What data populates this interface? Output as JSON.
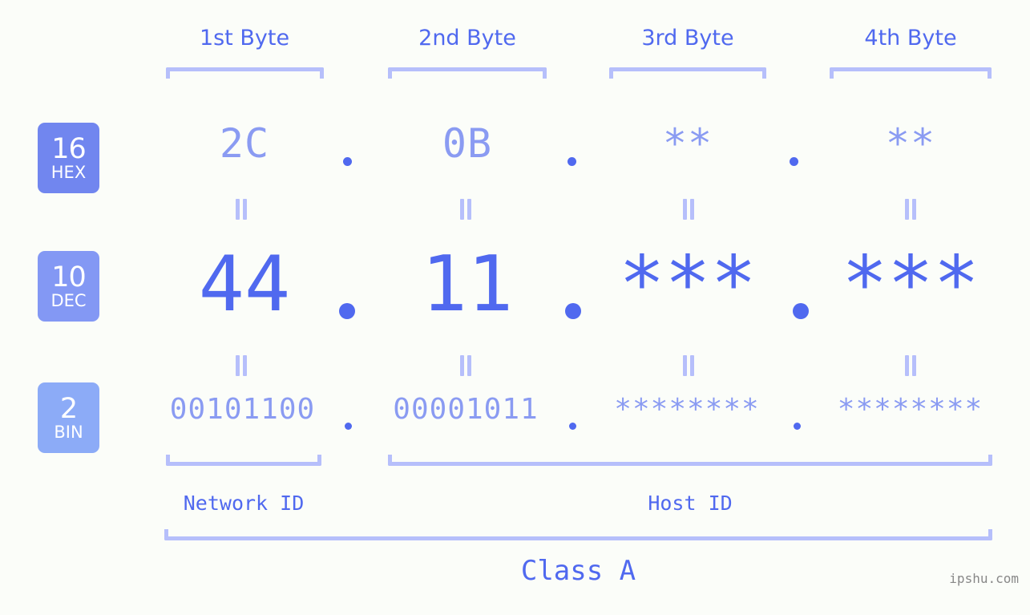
{
  "meta": {
    "watermark": "ipshu.com",
    "accent_strong": "#5069ef",
    "accent_mid": "#8a9bf2",
    "accent_light": "#b6bffb",
    "background": "#fbfdf9",
    "badge_hex_color": "#7186ef",
    "badge_dec_color": "#8398f4",
    "badge_bin_color": "#8cabf7"
  },
  "byte_headers": [
    {
      "label": "1st Byte"
    },
    {
      "label": "2nd Byte"
    },
    {
      "label": "3rd Byte"
    },
    {
      "label": "4th Byte"
    }
  ],
  "bases": [
    {
      "number": "16",
      "name": "HEX"
    },
    {
      "number": "10",
      "name": "DEC"
    },
    {
      "number": "2",
      "name": "BIN"
    }
  ],
  "rows": {
    "hex": {
      "values": [
        "2C",
        "0B",
        "**",
        "**"
      ],
      "separator": "."
    },
    "dec": {
      "values": [
        "44",
        "11",
        "***",
        "***"
      ],
      "separator": "."
    },
    "bin": {
      "values": [
        "00101100",
        "00001011",
        "********",
        "********"
      ],
      "separator": "."
    }
  },
  "equals_symbol": "‖",
  "sections": {
    "network_id": "Network ID",
    "host_id": "Host ID",
    "class": "Class A"
  }
}
